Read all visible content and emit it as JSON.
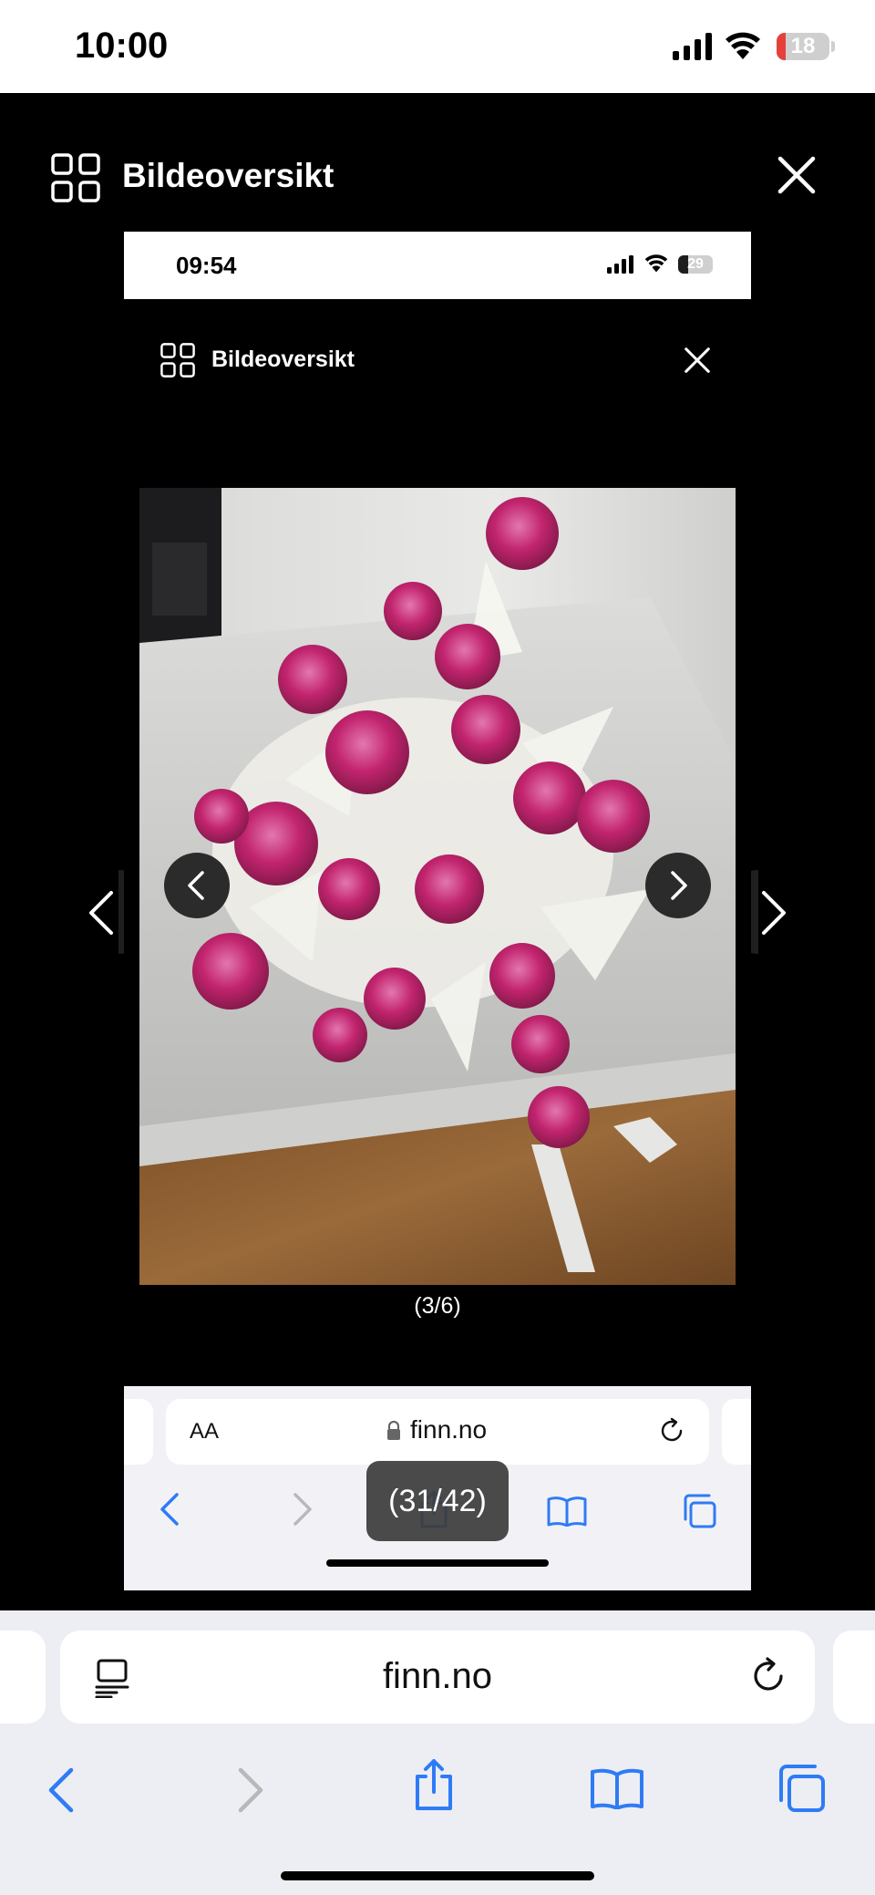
{
  "status_bar": {
    "time": "10:00",
    "battery": "18",
    "battery_level": 0.18
  },
  "viewer": {
    "title": "Bildeoversikt",
    "grid_icon": "grid-icon",
    "close_icon": "close-icon"
  },
  "inner_screenshot": {
    "status_bar": {
      "time": "09:54",
      "battery": "29",
      "battery_level": 0.29
    },
    "viewer": {
      "title": "Bildeoversikt"
    },
    "counter": "(3/6)",
    "browser": {
      "text_size": "AA",
      "domain": "finn.no"
    },
    "tooltip": "(31/42)"
  },
  "browser": {
    "domain": "finn.no"
  },
  "colors": {
    "accent": "#2f7bf6",
    "disabled": "#b8b8b8",
    "rose": "#c2246e",
    "wood": "#8b5a2b"
  }
}
